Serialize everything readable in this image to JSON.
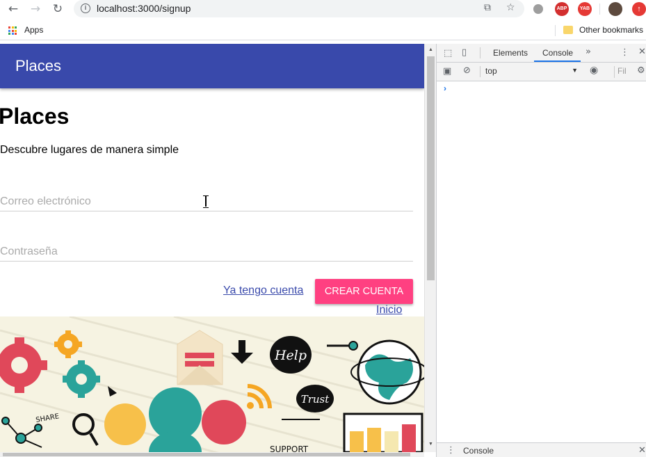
{
  "browser": {
    "url": "localhost:3000/signup",
    "bookmarks": {
      "apps_label": "Apps",
      "other_label": "Other bookmarks"
    },
    "extensions": [
      {
        "name": "abp-extension",
        "label": "ABP",
        "color": "#d32f2f"
      },
      {
        "name": "yab-extension",
        "label": "YAB",
        "color": "#e53935"
      }
    ]
  },
  "app": {
    "appbar_title": "Places",
    "page_title": "Places",
    "subtitle": "Descubre lugares de manera simple",
    "email_placeholder": "Correo electrónico",
    "password_placeholder": "Contraseña",
    "login_link": "Ya tengo cuenta",
    "create_button": "CREAR CUENTA",
    "home_link": "Inicio",
    "colors": {
      "primary": "#3949ab",
      "accent": "#ff4081"
    },
    "hero_texts": {
      "help": "Help",
      "trust": "Trust",
      "share": "SHARE",
      "support": "SUPPORT"
    }
  },
  "devtools": {
    "tabs": [
      "Elements",
      "Console"
    ],
    "active_tab": "Console",
    "context": "top",
    "filter_placeholder": "Fil",
    "prompt": "›",
    "drawer_label": "Console"
  }
}
